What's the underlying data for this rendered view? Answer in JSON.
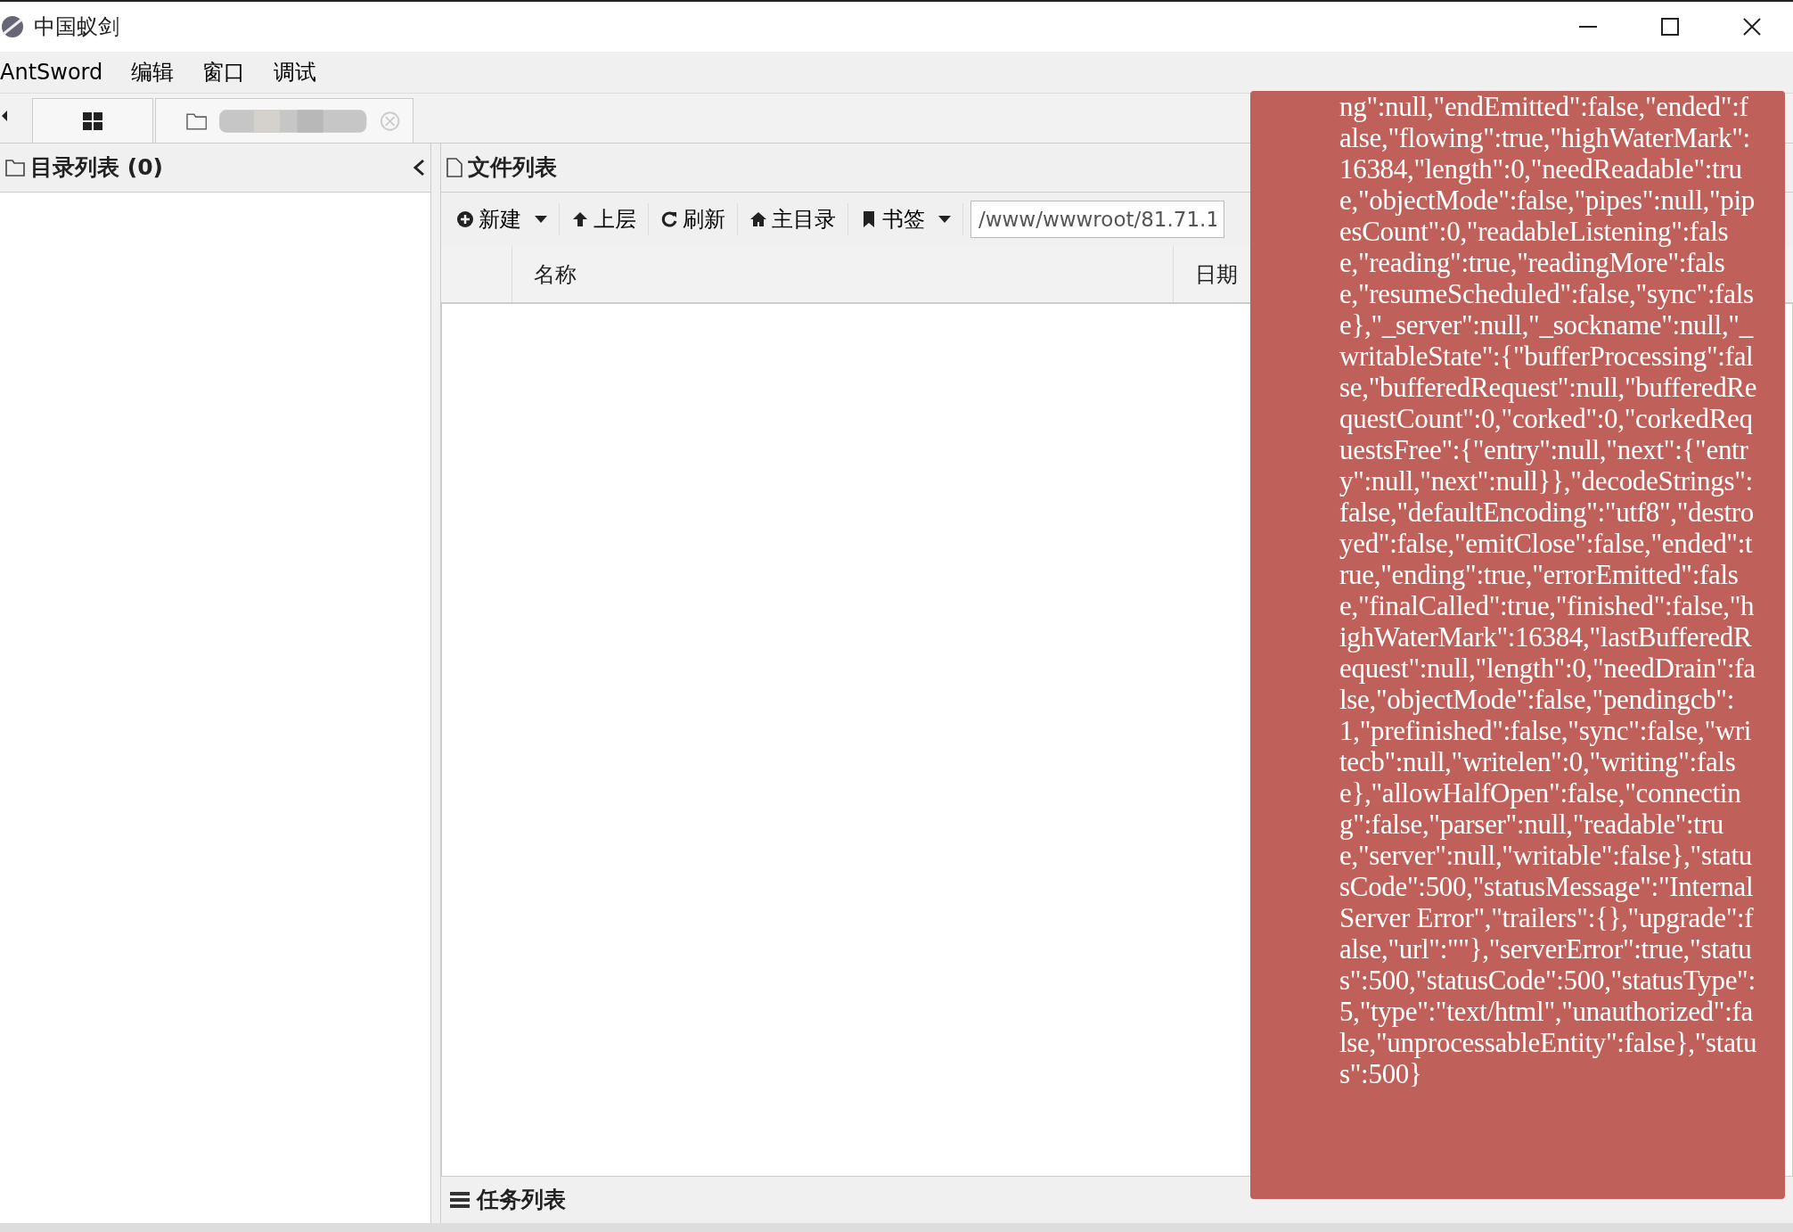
{
  "window": {
    "title": "中国蚁剑"
  },
  "menu": [
    {
      "label": "AntSword"
    },
    {
      "label": "编辑"
    },
    {
      "label": "窗口"
    },
    {
      "label": "调试"
    }
  ],
  "tabs": [
    {
      "kind": "home"
    },
    {
      "kind": "folder"
    }
  ],
  "dir_panel": {
    "title": "目录列表 (0)"
  },
  "file_panel": {
    "title": "文件列表",
    "toolbar": [
      {
        "label": "新建",
        "kind": "plus",
        "dropdown": true
      },
      {
        "label": "上层",
        "kind": "up",
        "dropdown": false
      },
      {
        "label": "刷新",
        "kind": "refresh",
        "dropdown": false
      },
      {
        "label": "主目录",
        "kind": "home",
        "dropdown": false
      },
      {
        "label": "书签",
        "kind": "bookmark",
        "dropdown": true
      }
    ],
    "path": "/www/wwwroot/81.71.1",
    "columns": [
      "名称",
      "日期"
    ]
  },
  "task_panel": {
    "title": "任务列表"
  },
  "toast": {
    "text": "ng\":null,\"endEmitted\":false,\"ended\":false,\"flowing\":true,\"highWaterMark\":16384,\"length\":0,\"needReadable\":true,\"objectMode\":false,\"pipes\":null,\"pipesCount\":0,\"readableListening\":false,\"reading\":true,\"readingMore\":false,\"resumeScheduled\":false,\"sync\":false},\"_server\":null,\"_sockname\":null,\"_writableState\":{\"bufferProcessing\":false,\"bufferedRequest\":null,\"bufferedRequestCount\":0,\"corked\":0,\"corkedRequestsFree\":{\"entry\":null,\"next\":{\"entry\":null,\"next\":null}},\"decodeStrings\":false,\"defaultEncoding\":\"utf8\",\"destroyed\":false,\"emitClose\":false,\"ended\":true,\"ending\":true,\"errorEmitted\":false,\"finalCalled\":true,\"finished\":false,\"highWaterMark\":16384,\"lastBufferedRequest\":null,\"length\":0,\"needDrain\":false,\"objectMode\":false,\"pendingcb\":1,\"prefinished\":false,\"sync\":false,\"writecb\":null,\"writelen\":0,\"writing\":false},\"allowHalfOpen\":false,\"connecting\":false,\"parser\":null,\"readable\":true,\"server\":null,\"writable\":false},\"statusCode\":500,\"statusMessage\":\"Internal Server Error\",\"trailers\":{},\"upgrade\":false,\"url\":\"\"},\"serverError\":true,\"status\":500,\"statusCode\":500,\"statusType\":5,\"type\":\"text/html\",\"unauthorized\":false,\"unprocessableEntity\":false},\"status\":500}"
  }
}
